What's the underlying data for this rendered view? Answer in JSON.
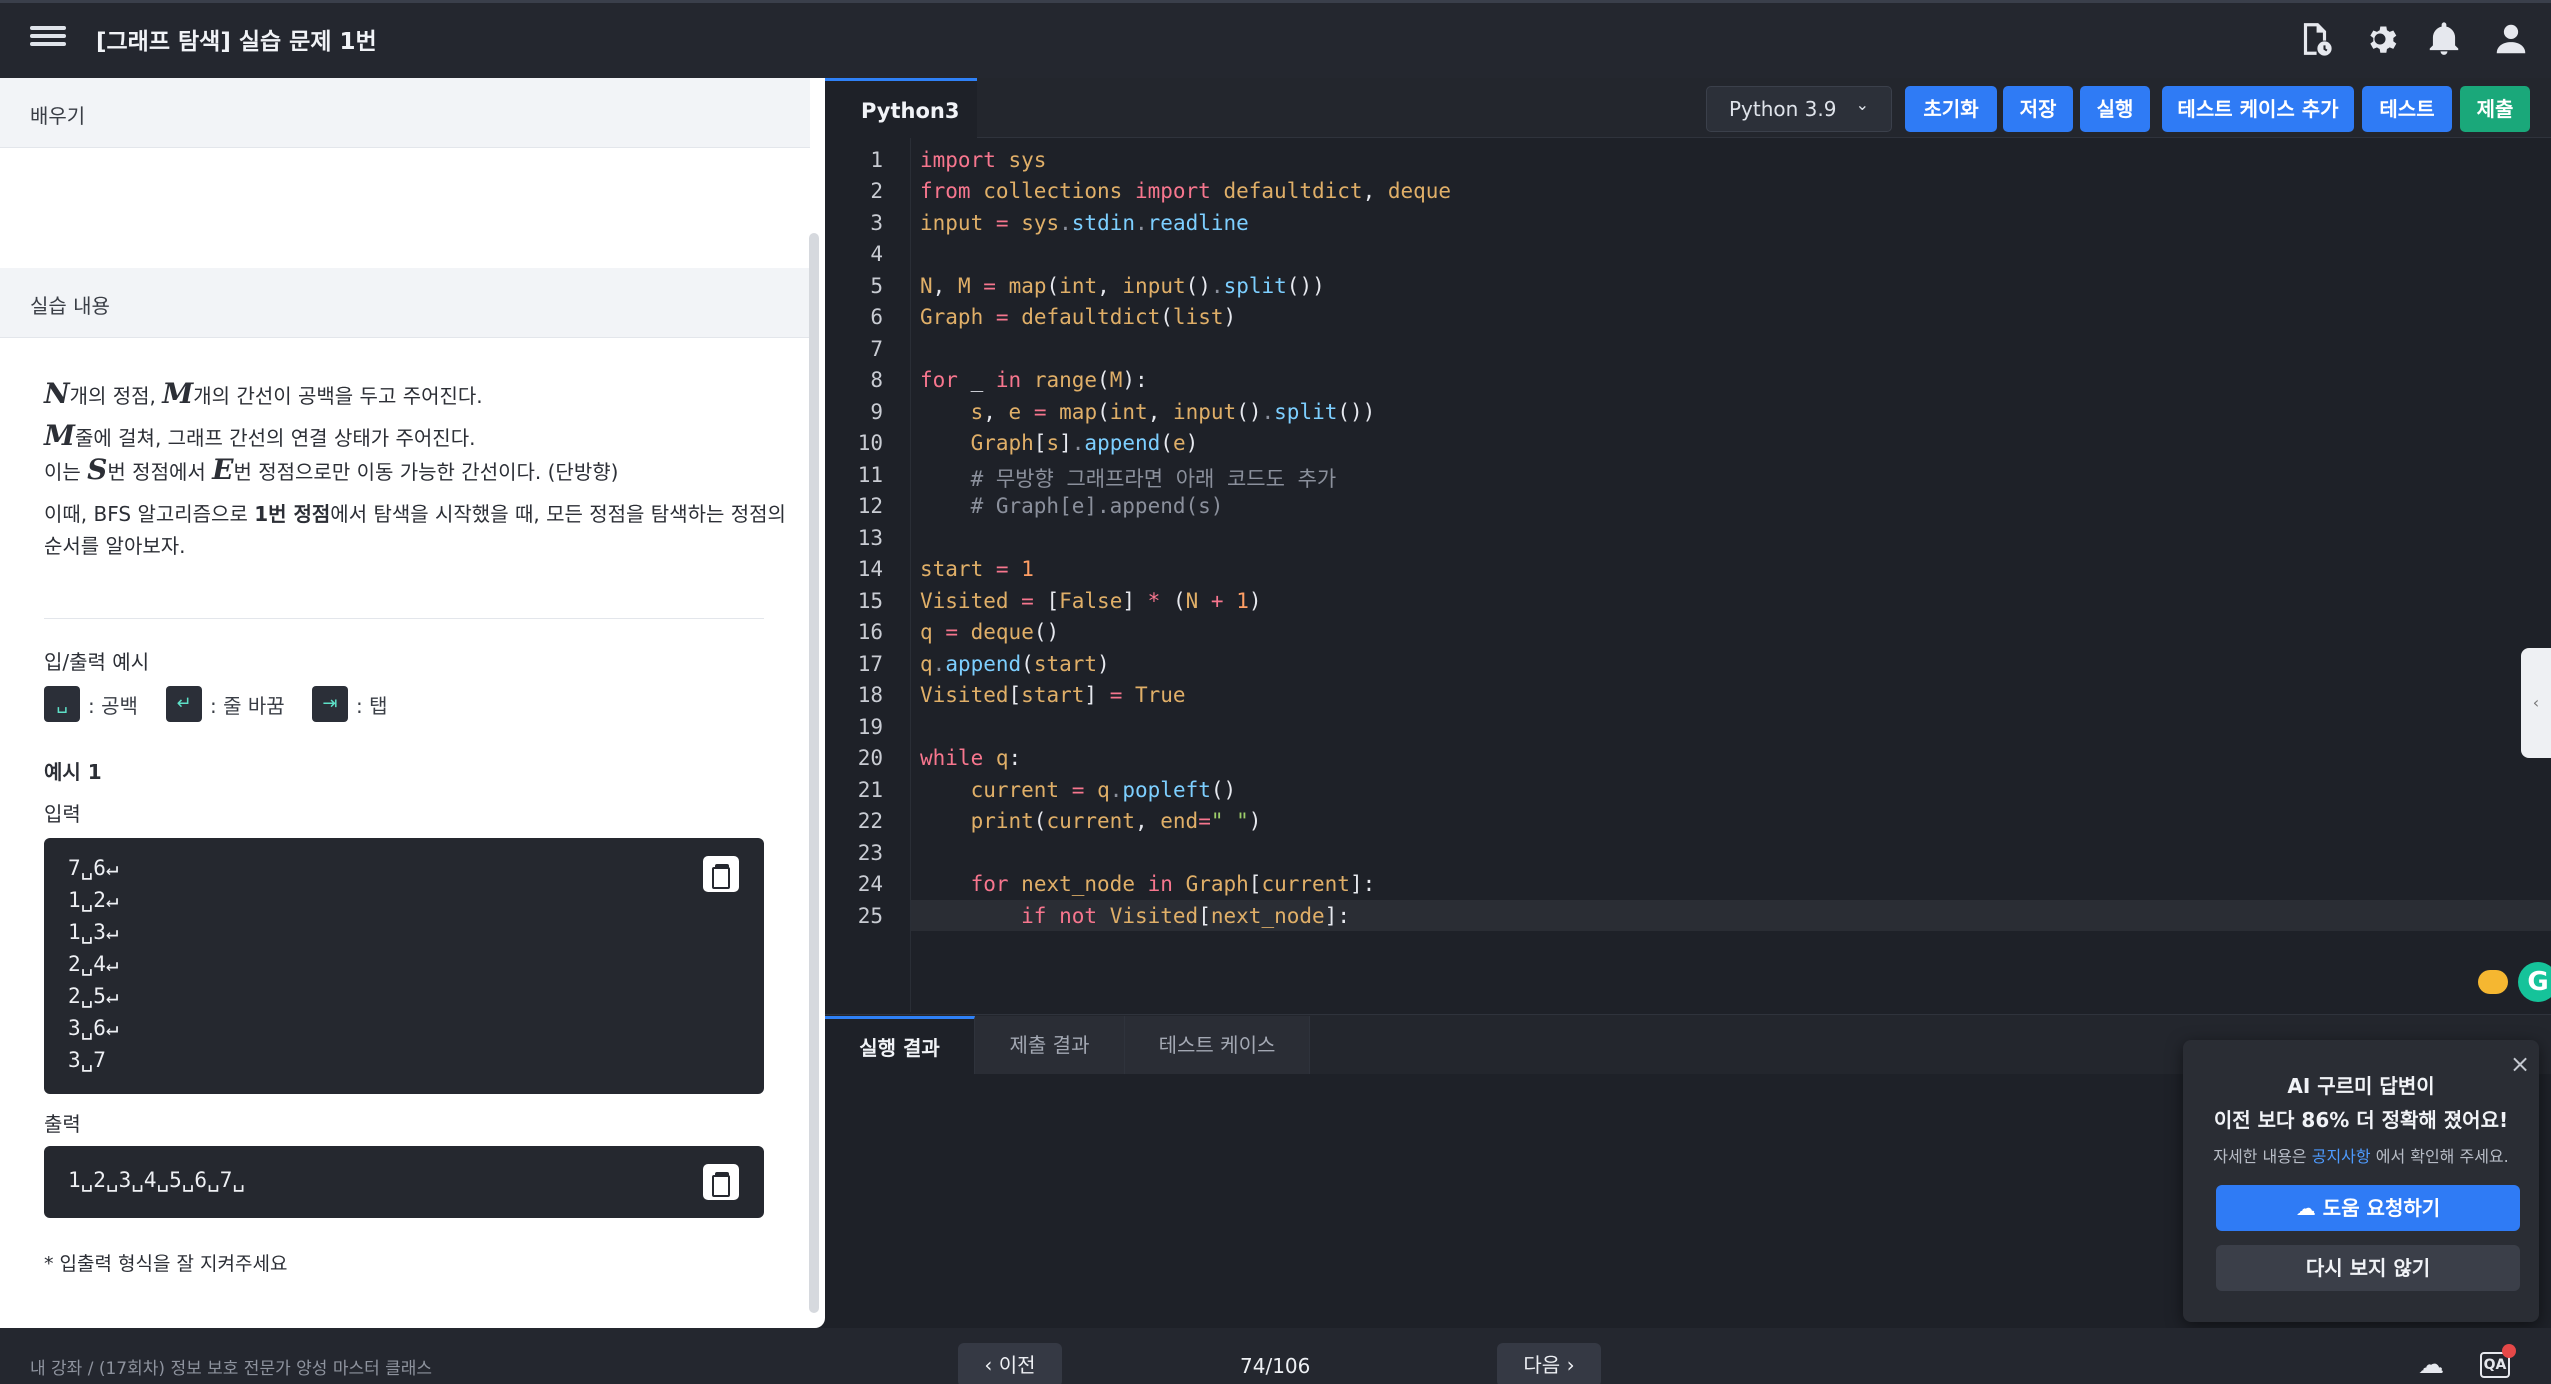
{
  "header": {
    "title": "[그래프 탐색] 실습 문제 1번",
    "icons": [
      "document-clock-icon",
      "gear-icon",
      "bell-icon",
      "user-icon"
    ]
  },
  "left": {
    "learn_label": "배우기",
    "practice_label": "실습 내용",
    "desc": {
      "var_n": "N",
      "line1_a": "개의 정점,",
      "var_m": "M",
      "line1_b": "개의 간선이 공백을 두고 주어진다.",
      "line2": "줄에 걸쳐, 그래프 간선의 연결 상태가 주어진다.",
      "line3_a": "이는",
      "var_s": "S",
      "line3_b": "번 정점에서",
      "var_e": "E",
      "line3_c": "번 정점으로만 이동 가능한 간선이다. (단방향)",
      "line4_a": "이때, BFS 알고리즘으로",
      "line4_bold": "1번 정점",
      "line4_b": "에서 탐색을 시작했을 때, 모든 정점을 탐색하는 정점의",
      "line5": "순서를 알아보자."
    },
    "io_label": "입/출력 예시",
    "legend": [
      {
        "symbol": "␣",
        "label": ": 공백"
      },
      {
        "symbol": "↵",
        "label": ": 줄 바꿈"
      },
      {
        "symbol": "⇥",
        "label": ": 탭"
      }
    ],
    "example_title": "예시 1",
    "input_label": "입력",
    "input_lines": [
      "7␣6↵",
      "1␣2↵",
      "1␣3↵",
      "2␣4↵",
      "2␣5↵",
      "3␣6↵",
      "3␣7"
    ],
    "output_label": "출력",
    "output_line": "1␣2␣3␣4␣5␣6␣7␣",
    "footnote": "* 입출력 형식을 잘 지켜주세요"
  },
  "editor": {
    "tab": "Python3",
    "language": "Python 3.9",
    "buttons": {
      "reset": "초기화",
      "save": "저장",
      "run": "실행",
      "add_test": "테스트 케이스 추가",
      "test": "테스트",
      "submit": "제출"
    },
    "accent": "#2f7bf5",
    "submit_color": "#1aa87a"
  },
  "output": {
    "tabs": [
      "실행 결과",
      "제출 결과",
      "테스트 케이스"
    ]
  },
  "popup": {
    "title1": "AI 구르미 답변이",
    "title2": "이전 보다 86% 더 정확해 졌어요!",
    "note_a": "자세한 내용은",
    "note_link": "공지사항",
    "note_b": "에서 확인해 주세요.",
    "primary": "도움 요청하기",
    "secondary": "다시 보지 않기"
  },
  "footer": {
    "breadcrumb": "내 강좌  /  (17회차) 정보 보호 전문가 양성 마스터 클래스",
    "prev": "이전",
    "next": "다음",
    "counter": "74/106"
  }
}
